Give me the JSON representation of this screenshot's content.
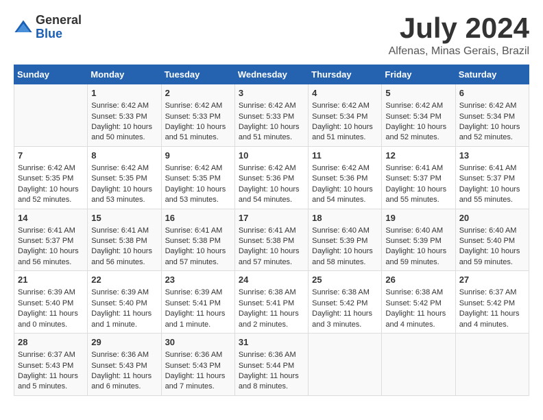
{
  "header": {
    "logo_general": "General",
    "logo_blue": "Blue",
    "month_year": "July 2024",
    "location": "Alfenas, Minas Gerais, Brazil"
  },
  "weekdays": [
    "Sunday",
    "Monday",
    "Tuesday",
    "Wednesday",
    "Thursday",
    "Friday",
    "Saturday"
  ],
  "weeks": [
    [
      {
        "day": "",
        "info": ""
      },
      {
        "day": "1",
        "info": "Sunrise: 6:42 AM\nSunset: 5:33 PM\nDaylight: 10 hours\nand 50 minutes."
      },
      {
        "day": "2",
        "info": "Sunrise: 6:42 AM\nSunset: 5:33 PM\nDaylight: 10 hours\nand 51 minutes."
      },
      {
        "day": "3",
        "info": "Sunrise: 6:42 AM\nSunset: 5:33 PM\nDaylight: 10 hours\nand 51 minutes."
      },
      {
        "day": "4",
        "info": "Sunrise: 6:42 AM\nSunset: 5:34 PM\nDaylight: 10 hours\nand 51 minutes."
      },
      {
        "day": "5",
        "info": "Sunrise: 6:42 AM\nSunset: 5:34 PM\nDaylight: 10 hours\nand 52 minutes."
      },
      {
        "day": "6",
        "info": "Sunrise: 6:42 AM\nSunset: 5:34 PM\nDaylight: 10 hours\nand 52 minutes."
      }
    ],
    [
      {
        "day": "7",
        "info": "Sunrise: 6:42 AM\nSunset: 5:35 PM\nDaylight: 10 hours\nand 52 minutes."
      },
      {
        "day": "8",
        "info": "Sunrise: 6:42 AM\nSunset: 5:35 PM\nDaylight: 10 hours\nand 53 minutes."
      },
      {
        "day": "9",
        "info": "Sunrise: 6:42 AM\nSunset: 5:35 PM\nDaylight: 10 hours\nand 53 minutes."
      },
      {
        "day": "10",
        "info": "Sunrise: 6:42 AM\nSunset: 5:36 PM\nDaylight: 10 hours\nand 54 minutes."
      },
      {
        "day": "11",
        "info": "Sunrise: 6:42 AM\nSunset: 5:36 PM\nDaylight: 10 hours\nand 54 minutes."
      },
      {
        "day": "12",
        "info": "Sunrise: 6:41 AM\nSunset: 5:37 PM\nDaylight: 10 hours\nand 55 minutes."
      },
      {
        "day": "13",
        "info": "Sunrise: 6:41 AM\nSunset: 5:37 PM\nDaylight: 10 hours\nand 55 minutes."
      }
    ],
    [
      {
        "day": "14",
        "info": "Sunrise: 6:41 AM\nSunset: 5:37 PM\nDaylight: 10 hours\nand 56 minutes."
      },
      {
        "day": "15",
        "info": "Sunrise: 6:41 AM\nSunset: 5:38 PM\nDaylight: 10 hours\nand 56 minutes."
      },
      {
        "day": "16",
        "info": "Sunrise: 6:41 AM\nSunset: 5:38 PM\nDaylight: 10 hours\nand 57 minutes."
      },
      {
        "day": "17",
        "info": "Sunrise: 6:41 AM\nSunset: 5:38 PM\nDaylight: 10 hours\nand 57 minutes."
      },
      {
        "day": "18",
        "info": "Sunrise: 6:40 AM\nSunset: 5:39 PM\nDaylight: 10 hours\nand 58 minutes."
      },
      {
        "day": "19",
        "info": "Sunrise: 6:40 AM\nSunset: 5:39 PM\nDaylight: 10 hours\nand 59 minutes."
      },
      {
        "day": "20",
        "info": "Sunrise: 6:40 AM\nSunset: 5:40 PM\nDaylight: 10 hours\nand 59 minutes."
      }
    ],
    [
      {
        "day": "21",
        "info": "Sunrise: 6:39 AM\nSunset: 5:40 PM\nDaylight: 11 hours\nand 0 minutes."
      },
      {
        "day": "22",
        "info": "Sunrise: 6:39 AM\nSunset: 5:40 PM\nDaylight: 11 hours\nand 1 minute."
      },
      {
        "day": "23",
        "info": "Sunrise: 6:39 AM\nSunset: 5:41 PM\nDaylight: 11 hours\nand 1 minute."
      },
      {
        "day": "24",
        "info": "Sunrise: 6:38 AM\nSunset: 5:41 PM\nDaylight: 11 hours\nand 2 minutes."
      },
      {
        "day": "25",
        "info": "Sunrise: 6:38 AM\nSunset: 5:42 PM\nDaylight: 11 hours\nand 3 minutes."
      },
      {
        "day": "26",
        "info": "Sunrise: 6:38 AM\nSunset: 5:42 PM\nDaylight: 11 hours\nand 4 minutes."
      },
      {
        "day": "27",
        "info": "Sunrise: 6:37 AM\nSunset: 5:42 PM\nDaylight: 11 hours\nand 4 minutes."
      }
    ],
    [
      {
        "day": "28",
        "info": "Sunrise: 6:37 AM\nSunset: 5:43 PM\nDaylight: 11 hours\nand 5 minutes."
      },
      {
        "day": "29",
        "info": "Sunrise: 6:36 AM\nSunset: 5:43 PM\nDaylight: 11 hours\nand 6 minutes."
      },
      {
        "day": "30",
        "info": "Sunrise: 6:36 AM\nSunset: 5:43 PM\nDaylight: 11 hours\nand 7 minutes."
      },
      {
        "day": "31",
        "info": "Sunrise: 6:36 AM\nSunset: 5:44 PM\nDaylight: 11 hours\nand 8 minutes."
      },
      {
        "day": "",
        "info": ""
      },
      {
        "day": "",
        "info": ""
      },
      {
        "day": "",
        "info": ""
      }
    ]
  ]
}
